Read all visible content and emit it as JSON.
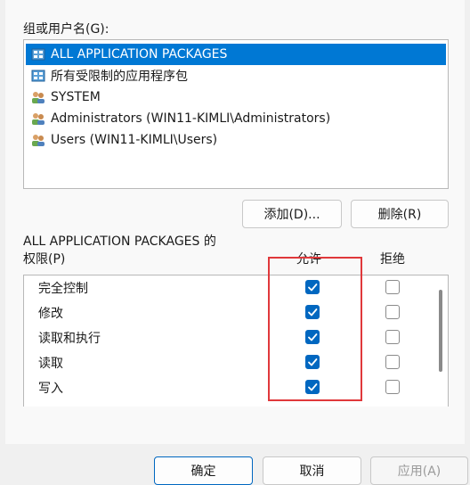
{
  "groups_label": "组或用户名(G):",
  "users": [
    {
      "name": "ALL APPLICATION PACKAGES",
      "icon": "app-packages-icon",
      "selected": true
    },
    {
      "name": "所有受限制的应用程序包",
      "icon": "app-packages-icon",
      "selected": false
    },
    {
      "name": "SYSTEM",
      "icon": "users-group-icon",
      "selected": false
    },
    {
      "name": "Administrators (WIN11-KIMLI\\Administrators)",
      "icon": "users-group-icon",
      "selected": false
    },
    {
      "name": "Users (WIN11-KIMLI\\Users)",
      "icon": "users-group-icon",
      "selected": false
    }
  ],
  "buttons": {
    "add": "添加(D)...",
    "remove": "删除(R)",
    "ok": "确定",
    "cancel": "取消",
    "apply": "应用(A)"
  },
  "permissions_title_line1": "ALL APPLICATION PACKAGES 的",
  "permissions_title_line2": "权限(P)",
  "columns": {
    "allow": "允许",
    "deny": "拒绝"
  },
  "permissions": [
    {
      "name": "完全控制",
      "allow": true,
      "deny": false
    },
    {
      "name": "修改",
      "allow": true,
      "deny": false
    },
    {
      "name": "读取和执行",
      "allow": true,
      "deny": false
    },
    {
      "name": "读取",
      "allow": true,
      "deny": false
    },
    {
      "name": "写入",
      "allow": true,
      "deny": false
    }
  ],
  "colors": {
    "accent": "#0067c0",
    "selection": "#0078d4",
    "highlight": "#e0383b"
  }
}
